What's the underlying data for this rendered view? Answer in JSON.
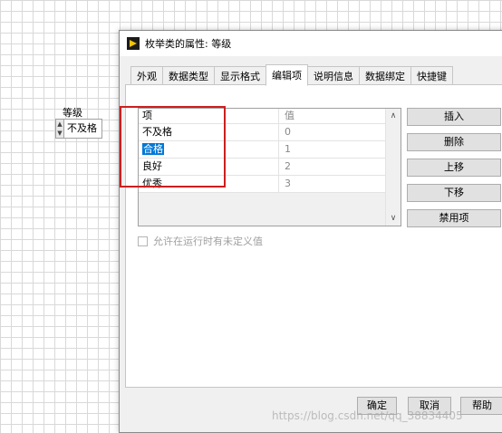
{
  "front_panel": {
    "control_label": "等级",
    "control_value": "不及格"
  },
  "dialog": {
    "title": "枚举类的属性: 等级",
    "tabs": [
      {
        "label": "外观"
      },
      {
        "label": "数据类型"
      },
      {
        "label": "显示格式"
      },
      {
        "label": "编辑项"
      },
      {
        "label": "说明信息"
      },
      {
        "label": "数据绑定"
      },
      {
        "label": "快捷键"
      }
    ],
    "active_tab": "编辑项",
    "list": {
      "header_item": "项",
      "header_value": "值",
      "rows": [
        {
          "item": "不及格",
          "value": "0"
        },
        {
          "item": "合格",
          "value": "1"
        },
        {
          "item": "良好",
          "value": "2"
        },
        {
          "item": "优秀",
          "value": "3"
        }
      ],
      "selected_row": 1
    },
    "side_buttons": {
      "insert": "插入",
      "delete": "删除",
      "move_up": "上移",
      "move_down": "下移",
      "disable": "禁用项"
    },
    "checkbox_label": "允许在运行时有未定义值",
    "footer_buttons": {
      "ok": "确定",
      "cancel": "取消",
      "help": "帮助"
    }
  },
  "watermark": "https://blog.csdn.net/qq_38834405",
  "colors": {
    "highlight": "#0078d7",
    "annotation_red": "#cc1f1f"
  }
}
